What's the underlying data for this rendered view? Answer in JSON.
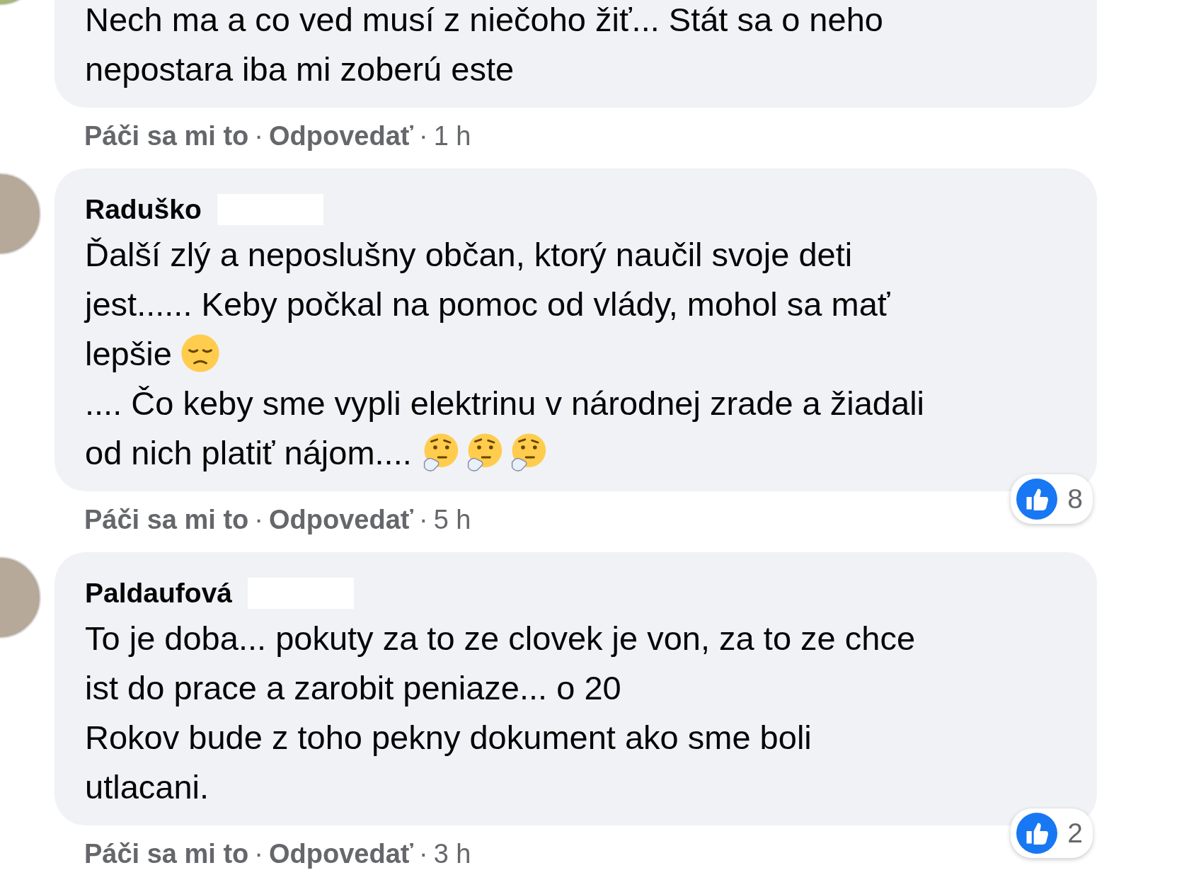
{
  "comments": [
    {
      "lines": [
        {
          "text": "Nech ma a co ved musí z niečoho žiť... Stát sa o neho"
        },
        {
          "text": "nepostara iba mi zoberú este"
        }
      ],
      "actions": [
        {
          "kind": "link",
          "text": "Páči sa mi to"
        },
        {
          "kind": "sep",
          "text": "·"
        },
        {
          "kind": "link",
          "text": "Odpovedať"
        },
        {
          "kind": "sep",
          "text": "·"
        },
        {
          "kind": "time",
          "text": "1 h"
        }
      ]
    },
    {
      "author": "Raduško",
      "redacted": true,
      "lines": [
        {
          "text": "Ďalší zlý a neposlušny občan, ktorý naučil svoje deti"
        },
        {
          "text": "jest...... Keby počkal na pomoc od vlády, mohol sa mať"
        },
        {
          "text": "lepšie",
          "emojis": [
            {
              "kind": "pensive"
            }
          ]
        },
        {
          "text": ".... Čo keby sme vypli elektrinu v národnej zrade a žiadali"
        },
        {
          "text": "od nich platiť nájom....",
          "emojis": [
            {
              "kind": "thinking"
            },
            {
              "kind": "thinking"
            },
            {
              "kind": "thinking"
            }
          ]
        }
      ],
      "reactions": "8",
      "actions": [
        {
          "kind": "link",
          "text": "Páči sa mi to"
        },
        {
          "kind": "sep",
          "text": "·"
        },
        {
          "kind": "link",
          "text": "Odpovedať"
        },
        {
          "kind": "sep",
          "text": "·"
        },
        {
          "kind": "time",
          "text": "5 h"
        }
      ]
    },
    {
      "author": "Paldaufová",
      "redacted": true,
      "lines": [
        {
          "text": "To je doba... pokuty za to ze clovek je von, za to ze chce"
        },
        {
          "text": "ist do prace a zarobit peniaze... o 20"
        },
        {
          "text": "Rokov bude z toho pekny dokument ako sme boli"
        },
        {
          "text": "utlacani."
        }
      ],
      "reactions": "2",
      "actions": [
        {
          "kind": "link",
          "text": "Páči sa mi to"
        },
        {
          "kind": "sep",
          "text": "·"
        },
        {
          "kind": "link",
          "text": "Odpovedať"
        },
        {
          "kind": "sep",
          "text": "·"
        },
        {
          "kind": "time",
          "text": "3 h"
        }
      ]
    }
  ]
}
